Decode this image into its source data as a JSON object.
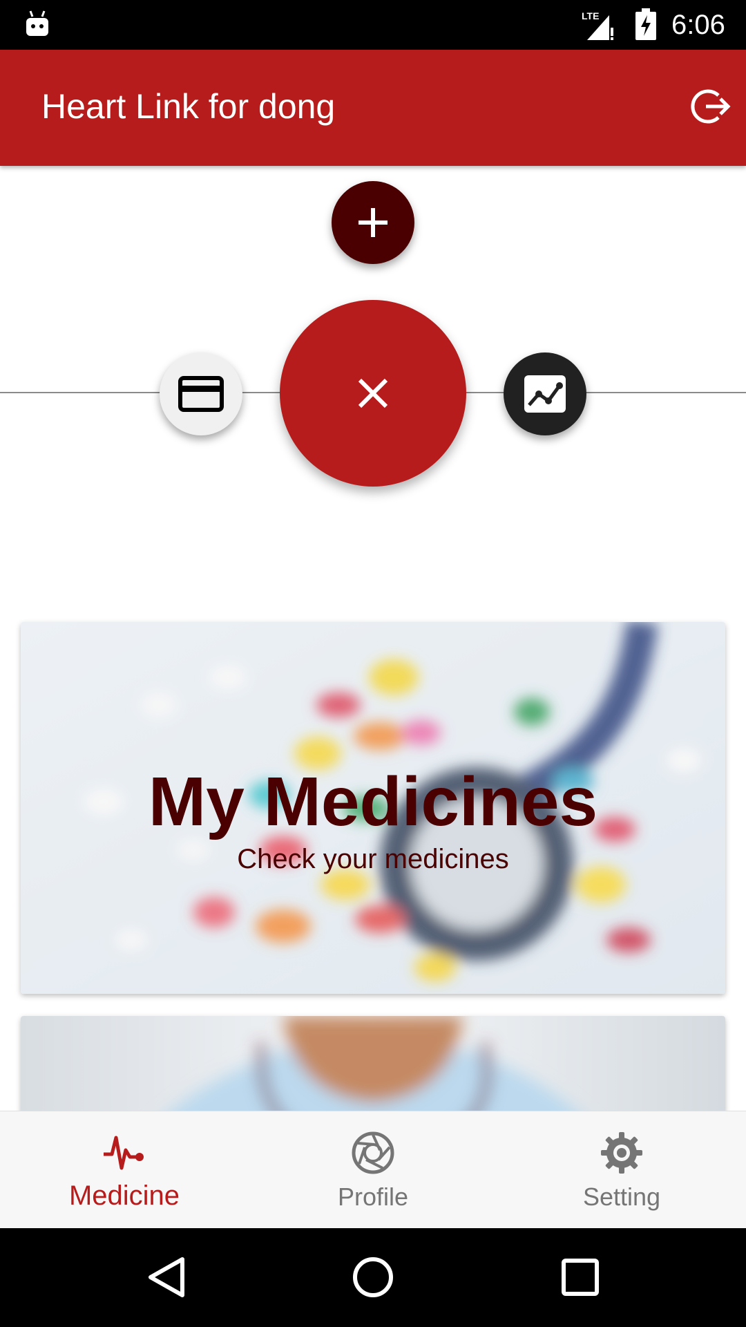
{
  "status_bar": {
    "time": "6:06",
    "network": "LTE",
    "icons": [
      "android-icon",
      "lte-signal-icon",
      "battery-charging-icon"
    ]
  },
  "app_bar": {
    "title": "Heart Link for dong",
    "action_icon": "logout-icon"
  },
  "fabs": {
    "add_icon": "plus-icon",
    "close_icon": "close-icon",
    "left_icon": "credit-card-icon",
    "right_icon": "chart-icon"
  },
  "cards": [
    {
      "title": "My Medicines",
      "subtitle": "Check your medicines",
      "image": "pills-and-stethoscope-photo"
    },
    {
      "image": "doctor-photo"
    }
  ],
  "bottom_nav": {
    "items": [
      {
        "label": "Medicine",
        "icon": "heartbeat-icon",
        "active": true
      },
      {
        "label": "Profile",
        "icon": "aperture-icon",
        "active": false
      },
      {
        "label": "Setting",
        "icon": "gear-icon",
        "active": false
      }
    ]
  },
  "colors": {
    "primary": "#b71c1c",
    "dark_accent": "#4a0000",
    "nav_inactive": "#757575"
  },
  "system_nav": [
    "back-icon",
    "home-icon",
    "recents-icon"
  ]
}
